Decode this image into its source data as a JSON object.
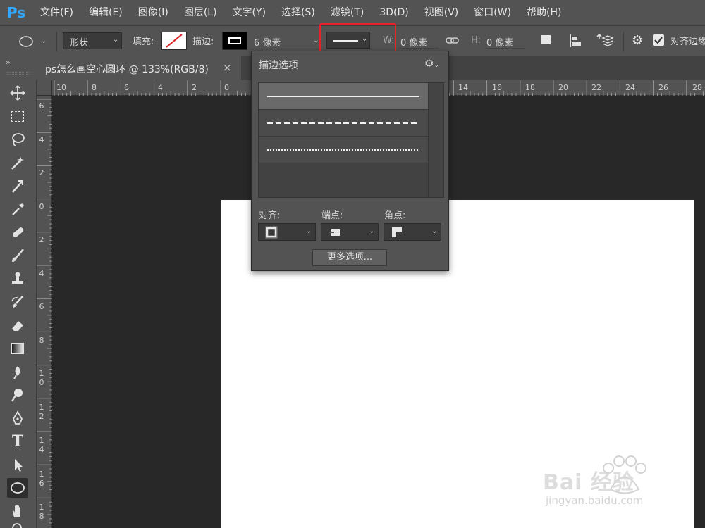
{
  "menu": {
    "logo": "Ps",
    "items": [
      "文件(F)",
      "编辑(E)",
      "图像(I)",
      "图层(L)",
      "文字(Y)",
      "选择(S)",
      "滤镜(T)",
      "3D(D)",
      "视图(V)",
      "窗口(W)",
      "帮助(H)"
    ]
  },
  "options": {
    "mode": "形状",
    "fill_label": "填充:",
    "stroke_label": "描边:",
    "stroke_width": "6 像素",
    "w_label": "W:",
    "w_value": "0 像素",
    "h_label": "H:",
    "h_value": "0 像素",
    "align_edges": "对齐边缘"
  },
  "document": {
    "tab_title": "ps怎么画空心圆环 @ 133%(RGB/8)",
    "close": "×"
  },
  "ruler": {
    "top": [
      "10",
      "8",
      "6",
      "4",
      "2",
      "0",
      "14",
      "16",
      "18",
      "20",
      "22",
      "24",
      "26",
      "28"
    ],
    "left": [
      "6",
      "4",
      "2",
      "0",
      "2",
      "4",
      "6",
      "8",
      "1\n0",
      "1\n2",
      "1\n4",
      "1\n6",
      "1\n8"
    ]
  },
  "stroke_popup": {
    "title": "描边选项",
    "styles": [
      "solid",
      "dashed",
      "dotted"
    ],
    "align_label": "对齐:",
    "caps_label": "端点:",
    "corners_label": "角点:",
    "more_button": "更多选项..."
  },
  "watermark": {
    "brand": "Bai 经验",
    "url": "jingyan.baidu.com"
  },
  "colors": {
    "highlight": "#e8202a",
    "ps_blue": "#31a8ff"
  }
}
